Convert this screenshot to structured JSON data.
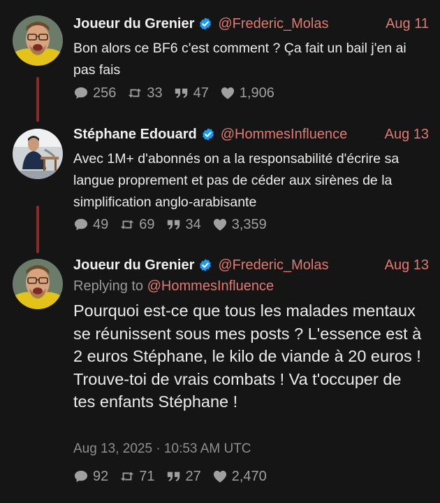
{
  "tweets": [
    {
      "author": "Joueur du Grenier",
      "handle": "@Frederic_Molas",
      "date": "Aug 11",
      "text": "Bon alors ce BF6 c'est comment ? Ça fait un bail j'en ai pas fais",
      "replies": "256",
      "retweets": "33",
      "quotes": "47",
      "likes": "1,906"
    },
    {
      "author": "Stéphane Edouard",
      "handle": "@HommesInfluence",
      "date": "Aug 13",
      "text": "Avec 1M+ d'abonnés on a la responsabilité d'écrire sa langue proprement et pas de céder aux sirènes de la simplification anglo-arabisante",
      "replies": "49",
      "retweets": "69",
      "quotes": "34",
      "likes": "3,359"
    },
    {
      "author": "Joueur du Grenier",
      "handle": "@Frederic_Molas",
      "date": "Aug 13",
      "replying_label": "Replying to",
      "replying_handle": "@HommesInfluence",
      "text": "Pourquoi est-ce que tous les malades mentaux se réunissent sous mes posts ? L'essence est à 2 euros Stéphane, le kilo de viande à 20 euros ! Trouve-toi de vrais combats ! Va t'occuper de tes enfants Stéphane !",
      "timestamp": "Aug 13, 2025 · 10:53 AM UTC",
      "replies": "92",
      "retweets": "71",
      "quotes": "27",
      "likes": "2,470"
    }
  ],
  "icons": {
    "verified": "verified-badge-icon",
    "reply": "comment-bubble-icon",
    "retweet": "retweet-icon",
    "quote": "quote-icon",
    "like": "heart-icon"
  },
  "colors": {
    "background": "#151515",
    "accent": "#e07a72",
    "verified": "#1d9bf0",
    "thread_line": "#8a2b2b"
  }
}
